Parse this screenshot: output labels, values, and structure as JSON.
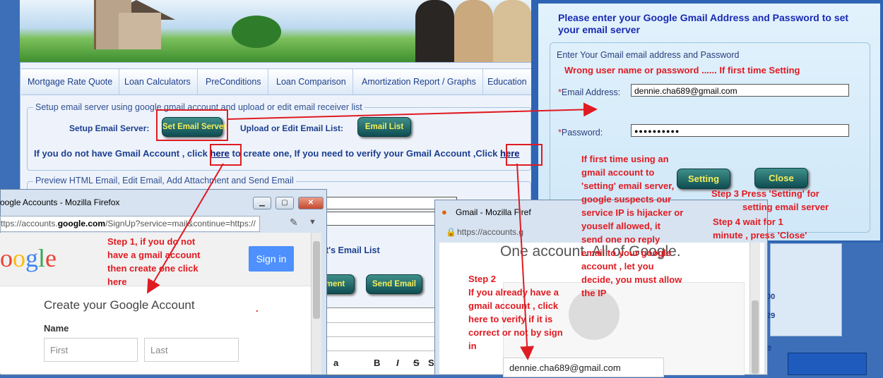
{
  "nav": [
    "Mortgage Rate Quote",
    "Loan Calculators",
    "PreConditions",
    "Loan Comparison",
    "Amortization Report / Graphs",
    "Education"
  ],
  "setup": {
    "legend": "Setup email server using google gmail account and upload or edit email receiver list",
    "server_label": "Setup Email Server:",
    "set_server_btn": "Set Email Server",
    "upload_label": "Upload or Edit Email List:",
    "email_list_btn": "Email List",
    "info_prefix": "If you do not have Gmail Account , click ",
    "info_here1": "here",
    "info_middle": " to create one, If you need to verify your Gmail Account ,Click ",
    "info_here2": "here"
  },
  "preview": {
    "legend": "Preview HTML Email, Edit Email, Add Attachment and Send Email",
    "email_list_label": "t's Email List",
    "attachment_btn": "hment",
    "send_btn": "Send Email",
    "toolbar": [
      "a",
      "B",
      "I",
      "S",
      "S"
    ]
  },
  "dialog": {
    "title": "Please enter your Google Gmail Address and Password to set your email server",
    "subtitle": "Enter Your Gmail email address and Password",
    "error": "Wrong user name or password ...... If first time Setting",
    "email_label": "Email Address:",
    "email_value": "dennie.cha689@gmail.com",
    "password_label": "Password:",
    "password_value": "●●●●●●●●●●",
    "star": "*",
    "setting_btn": "Setting",
    "close_btn": "Close"
  },
  "right_edge": {
    "v1": "00",
    "v2": "29",
    "v3": "e"
  },
  "ff1": {
    "title": "oogle Accounts - Mozilla Firefox",
    "url_prefix": "ttps://accounts.",
    "url_bold": "google.com",
    "url_rest": "/SignUp?service=mail&continue=https://",
    "logo": "oogle",
    "signin": "Sign in",
    "create": "Create your Google Account",
    "name_label": "Name",
    "first_ph": "First",
    "last_ph": "Last"
  },
  "ff2": {
    "title": "Gmail - Mozilla Firef",
    "url": "https://accounts.g",
    "heading": "One account. All of Google.",
    "email_value": "dennie.cha689@gmail.com"
  },
  "annotations": {
    "step1": [
      "Step 1, if you do not",
      "have a gmail account",
      "then create one click",
      "here"
    ],
    "step2": [
      "Step 2",
      "If you already have a",
      "gmail account , click",
      "here to verify if it is",
      "correct or not by sign",
      "in"
    ],
    "note": [
      "If first time using an",
      "gmail account to",
      "'setting' email server,",
      "google suspects our",
      "service IP is hijacker or",
      "youself allowed, it",
      "send one no reply",
      "email to your google",
      "account , let you",
      "decide, you must allow",
      "the IP"
    ],
    "step3": [
      "Step 3 Press 'Setting' for",
      "setting email server"
    ],
    "step4": [
      "Step 4 wait for 1",
      "minute , press 'Close'"
    ],
    "dot": "."
  },
  "colors": {
    "annotation_red": "#e01b22",
    "button_text": "#f6ef5a",
    "dialog_title": "#1a2bb3"
  }
}
